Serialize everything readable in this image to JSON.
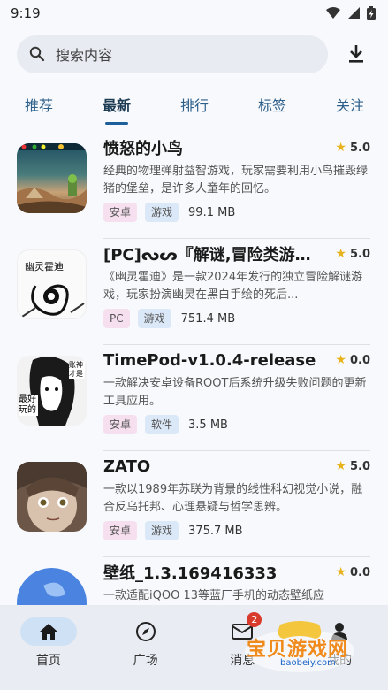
{
  "status_bar": {
    "time": "9:19"
  },
  "search": {
    "placeholder": "搜索内容"
  },
  "tabs": [
    {
      "label": "推荐"
    },
    {
      "label": "最新"
    },
    {
      "label": "排行"
    },
    {
      "label": "标签"
    },
    {
      "label": "关注"
    }
  ],
  "items": [
    {
      "title": "愤怒的小鸟",
      "rating": "5.0",
      "desc": "经典的物理弹射益智游戏，玩家需要利用小鸟摧毁绿猪的堡垒，是许多人童年的回忆。",
      "tags": [
        "安卓",
        "游戏"
      ],
      "size": "99.1 MB"
    },
    {
      "title": "[PC]ᔓᔕ『解谜,冒险类游戏...",
      "rating": "5.0",
      "thumb_text": "幽灵霍迪",
      "desc": "《幽灵霍迪》是一款2024年发行的独立冒险解谜游戏，玩家扮演幽灵在黑白手绘的死后...",
      "tags": [
        "PC",
        "游戏"
      ],
      "size": "751.4 MB"
    },
    {
      "title": "TimePod-v1.0.4-release",
      "rating": "0.0",
      "thumb_text_a": "最好玩的",
      "thumb_text_b": "账神才是",
      "desc": "一款解决安卓设备ROOT后系统升级失败问题的更新工具应用。",
      "tags": [
        "安卓",
        "软件"
      ],
      "size": "3.5 MB"
    },
    {
      "title": "ZATO",
      "rating": "5.0",
      "desc": "一款以1989年苏联为背景的线性科幻视觉小说，融合反乌托邦、心理悬疑与哲学思辨。",
      "tags": [
        "安卓",
        "游戏"
      ],
      "size": "375.7 MB"
    },
    {
      "title": "壁纸_1.3.169416333",
      "rating": "0.0",
      "desc": "一款适配iQOO 13等蓝厂手机的动态壁纸应",
      "tags": [],
      "size": ""
    }
  ],
  "bottom_nav": {
    "home": "首页",
    "plaza": "广场",
    "messages": "消息",
    "messages_badge": "2",
    "mine": "我的"
  },
  "watermark": {
    "line1": "宝贝游戏网",
    "line2": "baobeiy.com"
  }
}
